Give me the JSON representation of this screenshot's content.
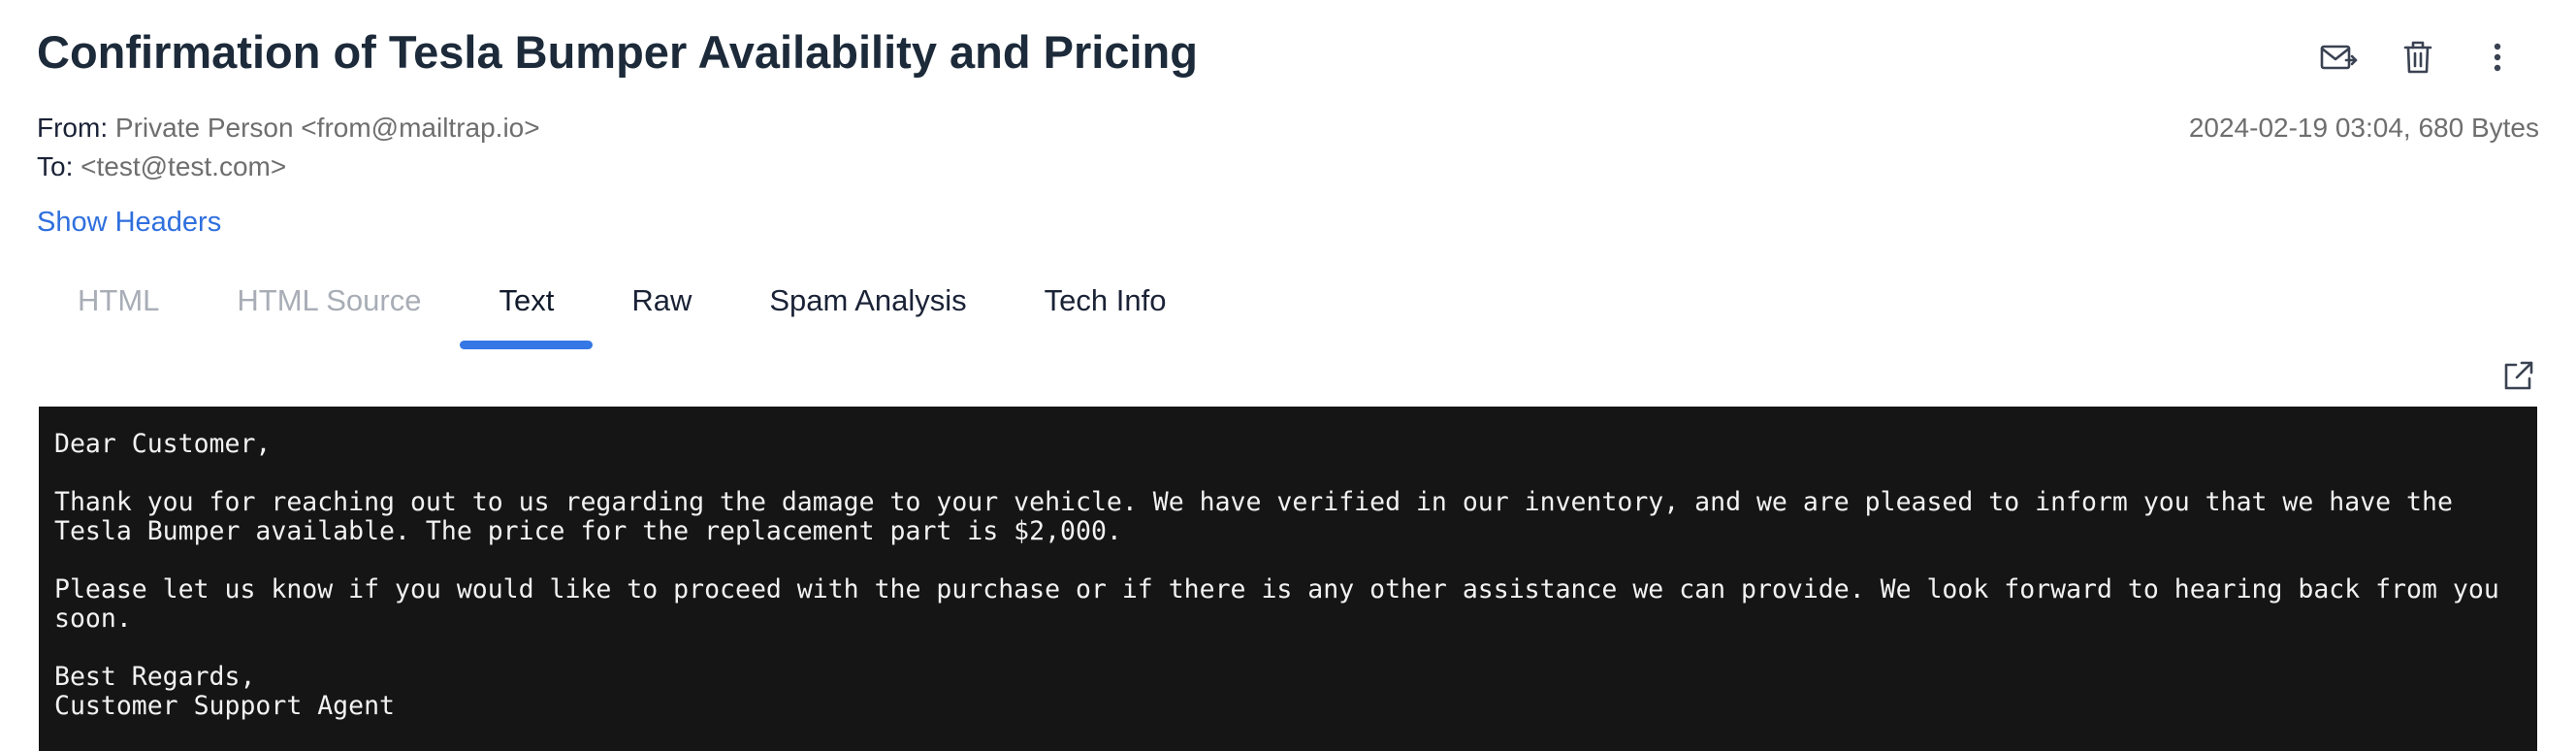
{
  "email": {
    "subject": "Confirmation of Tesla Bumper Availability and Pricing",
    "from_label": "From:",
    "from_value": "Private Person <from@mailtrap.io>",
    "to_label": "To:",
    "to_value": "<test@test.com>",
    "date_size": "2024-02-19 03:04, 680 Bytes",
    "show_headers": "Show Headers",
    "body": "Dear Customer,\n\nThank you for reaching out to us regarding the damage to your vehicle. We have verified in our inventory, and we are pleased to inform you that we have the Tesla Bumper available. The price for the replacement part is $2,000.\n\nPlease let us know if you would like to proceed with the purchase or if there is any other assistance we can provide. We look forward to hearing back from you soon.\n\nBest Regards,\nCustomer Support Agent"
  },
  "actions": {
    "forward_icon": "forward-mail-icon",
    "delete_icon": "trash-icon",
    "more_icon": "more-vertical-icon"
  },
  "tabs": [
    {
      "label": "HTML",
      "state": "disabled"
    },
    {
      "label": "HTML Source",
      "state": "disabled"
    },
    {
      "label": "Text",
      "state": "active"
    },
    {
      "label": "Raw",
      "state": "normal"
    },
    {
      "label": "Spam Analysis",
      "state": "normal"
    },
    {
      "label": "Tech Info",
      "state": "normal"
    }
  ],
  "colors": {
    "accent": "#3577e4",
    "link": "#2f6fde",
    "body_bg": "#151515",
    "body_text": "#f2f2f2"
  }
}
